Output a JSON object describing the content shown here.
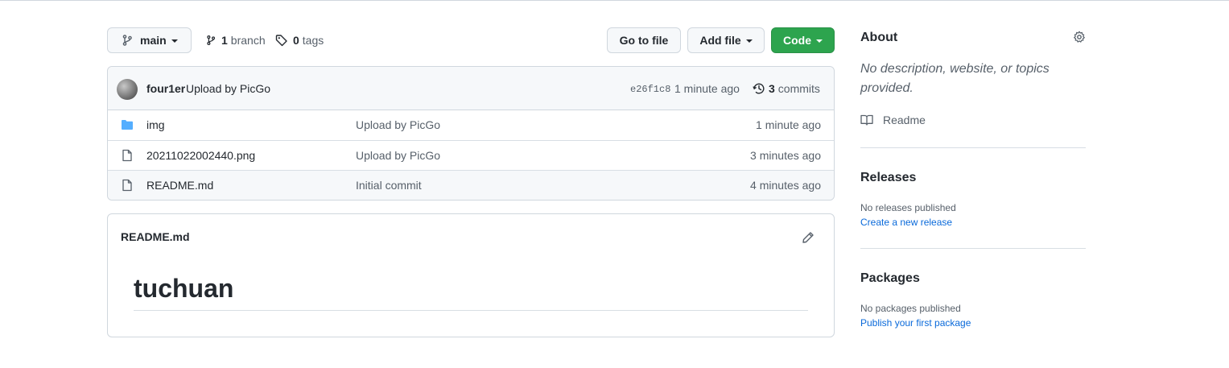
{
  "branch_selector": {
    "label": "main"
  },
  "branches": {
    "count": "1",
    "label": "branch"
  },
  "tags": {
    "count": "0",
    "label": "tags"
  },
  "actions": {
    "go_to_file": "Go to file",
    "add_file": "Add file",
    "code": "Code"
  },
  "commit": {
    "author": "four1er",
    "message": "Upload by PicGo",
    "sha": "e26f1c8",
    "time": "1 minute ago",
    "commits_count": "3",
    "commits_label": "commits"
  },
  "files": [
    {
      "name": "img",
      "type": "folder",
      "message": "Upload by PicGo",
      "age": "1 minute ago"
    },
    {
      "name": "20211022002440.png",
      "type": "file",
      "message": "Upload by PicGo",
      "age": "3 minutes ago"
    },
    {
      "name": "README.md",
      "type": "file",
      "message": "Initial commit",
      "age": "4 minutes ago"
    }
  ],
  "readme": {
    "filename": "README.md",
    "heading": "tuchuan"
  },
  "about": {
    "title": "About",
    "description": "No description, website, or topics provided.",
    "readme_label": "Readme"
  },
  "releases": {
    "title": "Releases",
    "empty_text": "No releases published",
    "link": "Create a new release"
  },
  "packages": {
    "title": "Packages",
    "empty_text": "No packages published",
    "link": "Publish your first package"
  },
  "colors": {
    "primary_button": "#2da44e",
    "link": "#0969da",
    "folder_icon": "#54aeff",
    "border": "#d0d7de"
  }
}
